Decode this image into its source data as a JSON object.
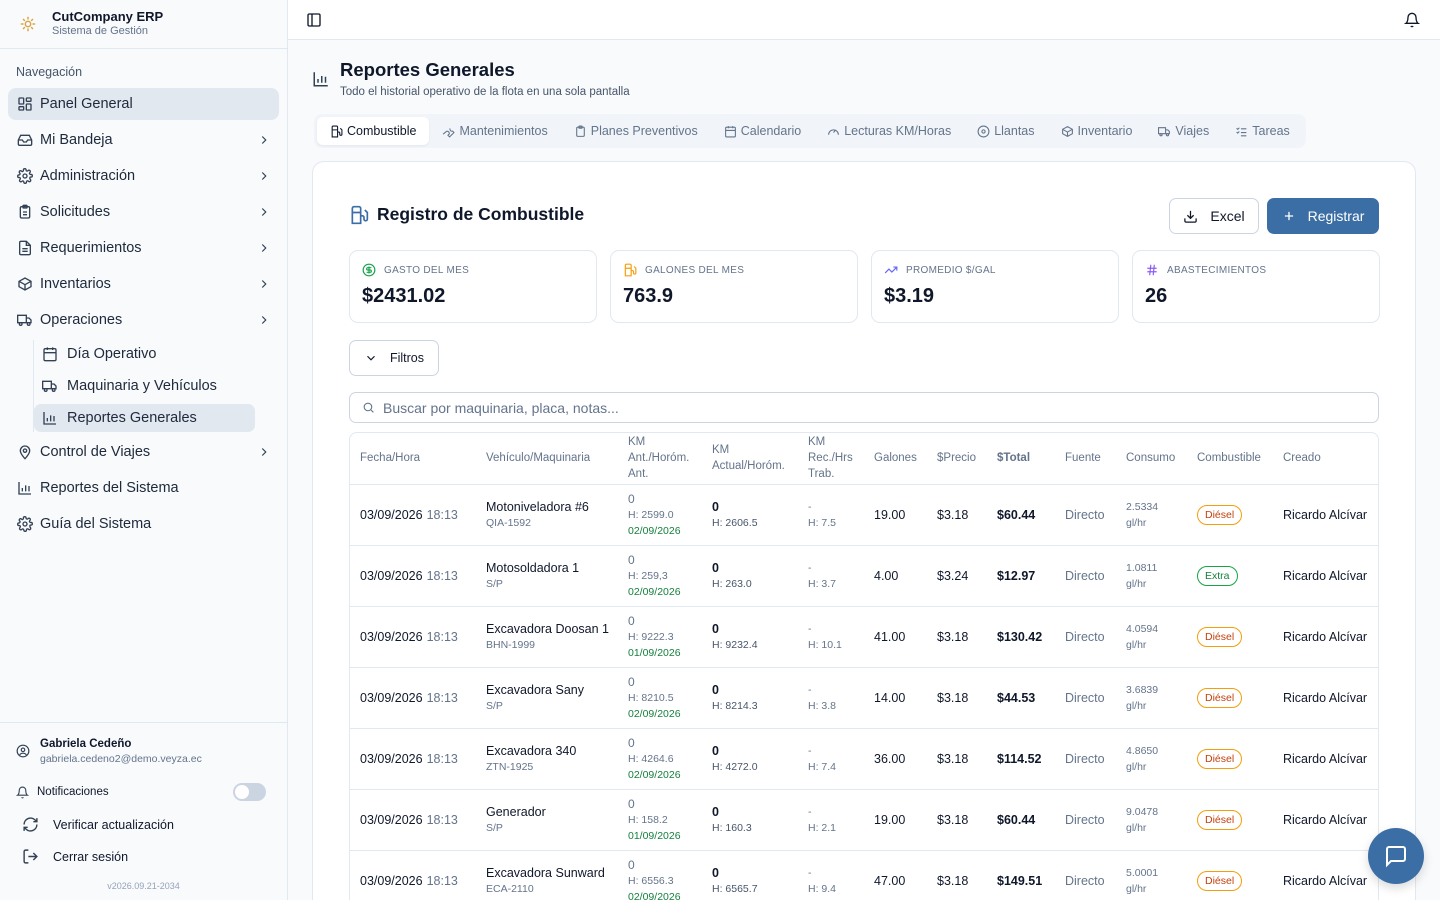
{
  "brand": {
    "title": "CutCompany ERP",
    "subtitle": "Sistema de Gestión"
  },
  "sidebar": {
    "section_label": "Navegación",
    "items": [
      {
        "label": "Panel General",
        "icon": "layout-grid-icon",
        "active": true
      },
      {
        "label": "Mi Bandeja",
        "icon": "inbox-icon"
      },
      {
        "label": "Administración",
        "icon": "gear-icon"
      },
      {
        "label": "Solicitudes",
        "icon": "clipboard-icon"
      },
      {
        "label": "Requerimientos",
        "icon": "file-icon"
      },
      {
        "label": "Inventarios",
        "icon": "package-icon"
      },
      {
        "label": "Operaciones",
        "icon": "truck-icon"
      },
      {
        "label": "Control de Viajes",
        "icon": "map-pin-icon"
      },
      {
        "label": "Reportes del Sistema",
        "icon": "bar-chart-icon"
      },
      {
        "label": "Guía del Sistema",
        "icon": "gear-icon"
      }
    ],
    "sub_items": [
      {
        "label": "Día Operativo",
        "icon": "calendar-icon"
      },
      {
        "label": "Maquinaria y Vehículos",
        "icon": "truck-icon"
      },
      {
        "label": "Reportes Generales",
        "icon": "bar-chart-icon",
        "active": true
      }
    ]
  },
  "footer": {
    "user_name": "Gabriela Cedeño",
    "user_email": "gabriela.cedeno2@demo.veyza.ec",
    "notifications_label": "Notificaciones",
    "check_update_label": "Verificar actualización",
    "logout_label": "Cerrar sesión",
    "version": "v2026.09.21-2034"
  },
  "page": {
    "title": "Reportes Generales",
    "subtitle": "Todo el historial operativo de la flota en una sola pantalla"
  },
  "tabs": [
    {
      "label": "Combustible",
      "active": true
    },
    {
      "label": "Mantenimientos"
    },
    {
      "label": "Planes Preventivos"
    },
    {
      "label": "Calendario"
    },
    {
      "label": "Lecturas KM/Horas"
    },
    {
      "label": "Llantas"
    },
    {
      "label": "Inventario"
    },
    {
      "label": "Viajes"
    },
    {
      "label": "Tareas"
    }
  ],
  "section": {
    "title": "Registro de Combustible",
    "excel_label": "Excel",
    "register_label": "Registrar",
    "filters_label": "Filtros",
    "search_placeholder": "Buscar por maquinaria, placa, notas..."
  },
  "stats": [
    {
      "label": "GASTO DEL MES",
      "value": "$2431.02",
      "color": "#16a34a"
    },
    {
      "label": "GALONES DEL MES",
      "value": "763.9",
      "color": "#f59e0b"
    },
    {
      "label": "PROMEDIO $/GAL",
      "value": "$3.19",
      "color": "#6366f1"
    },
    {
      "label": "ABASTECIMIENTOS",
      "value": "26",
      "color": "#8b5cf6"
    }
  ],
  "table": {
    "headers": [
      "Fecha/Hora",
      "Vehículo/Maquinaria",
      "KM Ant./Horóm. Ant.",
      "KM Actual/Horóm.",
      "KM Rec./Hrs Trab.",
      "Galones",
      "$Precio",
      "$Total",
      "Fuente",
      "Consumo",
      "Combustible",
      "Creado"
    ],
    "rows": [
      {
        "date": "03/09/2026",
        "time": "18:13",
        "vehicle": "Motoniveladora #6",
        "plate": "QIA-1592",
        "km_ant": "0",
        "h_ant": "H: 2599.0",
        "d_ant": "02/09/2026",
        "km_act": "0",
        "h_act": "H: 2606.5",
        "km_rec": "-",
        "h_rec": "H: 7.5",
        "gal": "19.00",
        "price": "$3.18",
        "total": "$60.44",
        "source": "Directo",
        "cons": "2.5334",
        "cons_unit": "gl/hr",
        "fuel": "Diésel",
        "fuel_type": "diesel",
        "creator": "Ricardo Alcívar"
      },
      {
        "date": "03/09/2026",
        "time": "18:13",
        "vehicle": "Motosoldadora 1",
        "plate": "S/P",
        "km_ant": "0",
        "h_ant": "H: 259,3",
        "d_ant": "02/09/2026",
        "km_act": "0",
        "h_act": "H: 263.0",
        "km_rec": "-",
        "h_rec": "H: 3.7",
        "gal": "4.00",
        "price": "$3.24",
        "total": "$12.97",
        "source": "Directo",
        "cons": "1.0811",
        "cons_unit": "gl/hr",
        "fuel": "Extra",
        "fuel_type": "extra",
        "creator": "Ricardo Alcívar"
      },
      {
        "date": "03/09/2026",
        "time": "18:13",
        "vehicle": "Excavadora Doosan 1",
        "plate": "BHN-1999",
        "km_ant": "0",
        "h_ant": "H: 9222.3",
        "d_ant": "01/09/2026",
        "km_act": "0",
        "h_act": "H: 9232.4",
        "km_rec": "-",
        "h_rec": "H: 10.1",
        "gal": "41.00",
        "price": "$3.18",
        "total": "$130.42",
        "source": "Directo",
        "cons": "4.0594",
        "cons_unit": "gl/hr",
        "fuel": "Diésel",
        "fuel_type": "diesel",
        "creator": "Ricardo Alcívar"
      },
      {
        "date": "03/09/2026",
        "time": "18:13",
        "vehicle": "Excavadora Sany",
        "plate": "S/P",
        "km_ant": "0",
        "h_ant": "H: 8210.5",
        "d_ant": "02/09/2026",
        "km_act": "0",
        "h_act": "H: 8214.3",
        "km_rec": "-",
        "h_rec": "H: 3.8",
        "gal": "14.00",
        "price": "$3.18",
        "total": "$44.53",
        "source": "Directo",
        "cons": "3.6839",
        "cons_unit": "gl/hr",
        "fuel": "Diésel",
        "fuel_type": "diesel",
        "creator": "Ricardo Alcívar"
      },
      {
        "date": "03/09/2026",
        "time": "18:13",
        "vehicle": "Excavadora 340",
        "plate": "ZTN-1925",
        "km_ant": "0",
        "h_ant": "H: 4264.6",
        "d_ant": "02/09/2026",
        "km_act": "0",
        "h_act": "H: 4272.0",
        "km_rec": "-",
        "h_rec": "H: 7.4",
        "gal": "36.00",
        "price": "$3.18",
        "total": "$114.52",
        "source": "Directo",
        "cons": "4.8650",
        "cons_unit": "gl/hr",
        "fuel": "Diésel",
        "fuel_type": "diesel",
        "creator": "Ricardo Alcívar"
      },
      {
        "date": "03/09/2026",
        "time": "18:13",
        "vehicle": "Generador",
        "plate": "S/P",
        "km_ant": "0",
        "h_ant": "H: 158.2",
        "d_ant": "01/09/2026",
        "km_act": "0",
        "h_act": "H: 160.3",
        "km_rec": "-",
        "h_rec": "H: 2.1",
        "gal": "19.00",
        "price": "$3.18",
        "total": "$60.44",
        "source": "Directo",
        "cons": "9.0478",
        "cons_unit": "gl/hr",
        "fuel": "Diésel",
        "fuel_type": "diesel",
        "creator": "Ricardo Alcívar"
      },
      {
        "date": "03/09/2026",
        "time": "18:13",
        "vehicle": "Excavadora Sunward",
        "plate": "ECA-2110",
        "km_ant": "0",
        "h_ant": "H: 6556.3",
        "d_ant": "02/09/2026",
        "km_act": "0",
        "h_act": "H: 6565.7",
        "km_rec": "-",
        "h_rec": "H: 9.4",
        "gal": "47.00",
        "price": "$3.18",
        "total": "$149.51",
        "source": "Directo",
        "cons": "5.0001",
        "cons_unit": "gl/hr",
        "fuel": "Diésel",
        "fuel_type": "diesel",
        "creator": "Ricardo Alcívar"
      }
    ]
  }
}
